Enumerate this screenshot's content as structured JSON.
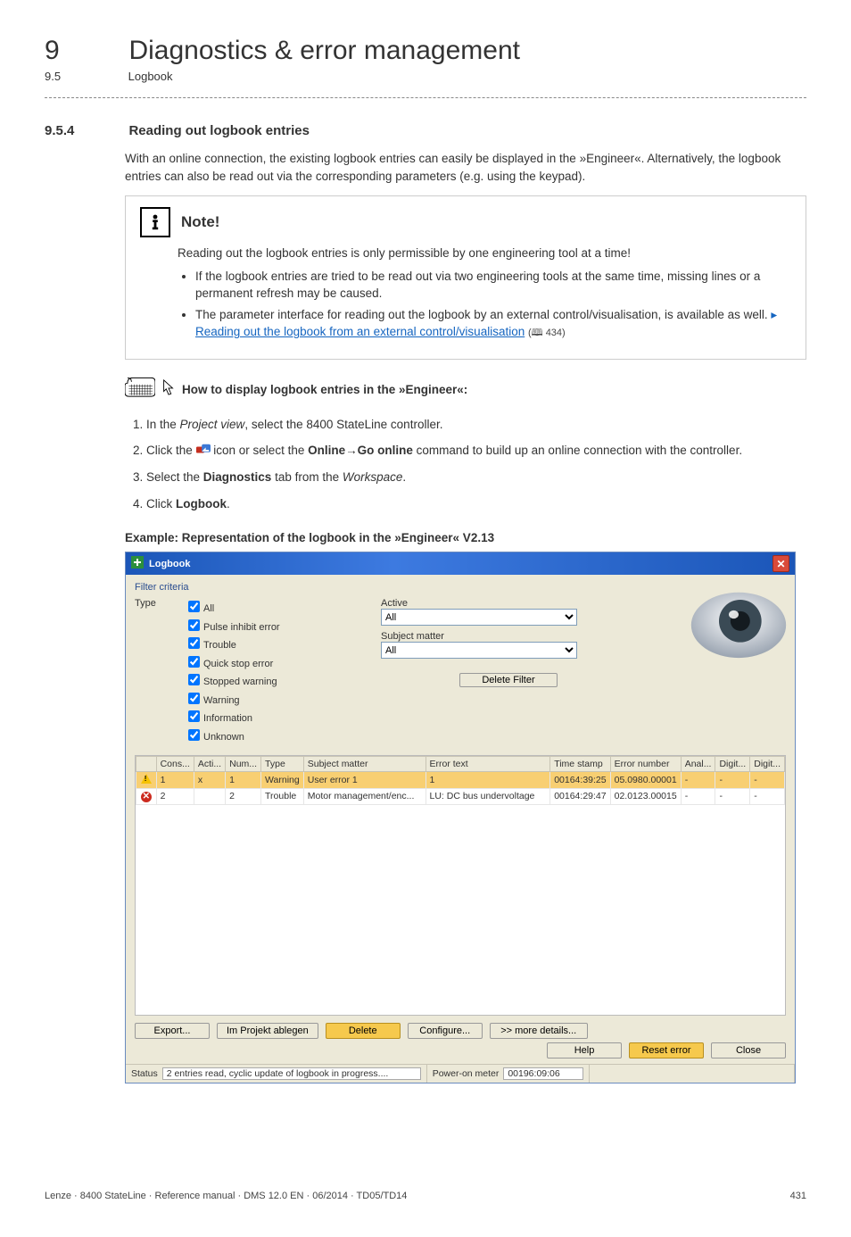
{
  "header": {
    "chapter_num": "9",
    "chapter_title": "Diagnostics & error management",
    "sub_num": "9.5",
    "sub_title": "Logbook"
  },
  "section": {
    "num": "9.5.4",
    "title": "Reading out logbook entries"
  },
  "intro": "With an online connection, the existing logbook entries can easily be displayed in the »Engineer«. Alternatively, the logbook entries can also be read out via the corresponding parameters (e.g. using the keypad).",
  "note": {
    "label": "Note!",
    "line1": "Reading out the logbook entries is only permissible by one engineering tool at a time!",
    "bullet1": "If the logbook entries are tried to be read out via two engineering tools at the same time, missing lines or a permanent refresh may be caused.",
    "bullet2a": "The parameter interface for reading out the logbook by an external control/visualisation, is available as well.",
    "link": "Reading out the logbook from an external control/visualisation",
    "pageref": "(🕮 434)"
  },
  "howto": {
    "heading": "How to display logbook entries in the »Engineer«:",
    "step1a": "In the ",
    "step1_em": "Project view",
    "step1b": ", select the 8400 StateLine controller.",
    "step2a": "Click the ",
    "step2b": " icon or select the ",
    "step2_cmd": "Online→Go online",
    "step2c": " command to build up an online connection with the controller.",
    "step3a": "Select the ",
    "step3_b": "Diagnostics",
    "step3b": " tab from the ",
    "step3_em": "Workspace",
    "step3c": ".",
    "step4a": "Click ",
    "step4_b": "Logbook",
    "step4b": "."
  },
  "example_caption": "Example: Representation of the logbook in the »Engineer« V2.13",
  "logbook": {
    "title": "Logbook",
    "filter_criteria": "Filter criteria",
    "type_label": "Type",
    "chk": {
      "all": "All",
      "pie": "Pulse inhibit error",
      "trouble": "Trouble",
      "qse": "Quick stop error",
      "sw": "Stopped warning",
      "warn": "Warning",
      "info": "Information",
      "unk": "Unknown"
    },
    "active_label": "Active",
    "subject_label": "Subject matter",
    "dd_all": "All",
    "delete_filter": "Delete Filter",
    "cols": {
      "cons": "Cons...",
      "acti": "Acti...",
      "num": "Num...",
      "type": "Type",
      "subj": "Subject matter",
      "err": "Error text",
      "time": "Time stamp",
      "errnum": "Error number",
      "anal": "Anal...",
      "dig1": "Digit...",
      "dig2": "Digit..."
    },
    "rows": [
      {
        "icon": "warn",
        "cons": "1",
        "acti": "x",
        "num": "1",
        "type": "Warning",
        "subj": "User error 1",
        "err": "1",
        "time": "00164:39:25",
        "errnum": "05.0980.00001",
        "anal": "-",
        "dig1": "-",
        "dig2": "-",
        "selected": true
      },
      {
        "icon": "redx",
        "cons": "2",
        "acti": "",
        "num": "2",
        "type": "Trouble",
        "subj": "Motor management/enc...",
        "err": "LU: DC bus undervoltage",
        "time": "00164:29:47",
        "errnum": "02.0123.00015",
        "anal": "-",
        "dig1": "-",
        "dig2": "-",
        "selected": false
      }
    ],
    "buttons": {
      "export": "Export...",
      "improj": "Im Projekt ablegen",
      "delete": "Delete",
      "configure": "Configure...",
      "more": ">> more details...",
      "help": "Help",
      "reset": "Reset error",
      "close": "Close"
    },
    "status": {
      "label": "Status",
      "text": "2 entries read, cyclic update of logbook in progress....",
      "pom_label": "Power-on meter",
      "pom_value": "00196:09:06"
    }
  },
  "footer": {
    "left": "Lenze · 8400 StateLine · Reference manual · DMS 12.0 EN · 06/2014 · TD05/TD14",
    "right": "431"
  }
}
